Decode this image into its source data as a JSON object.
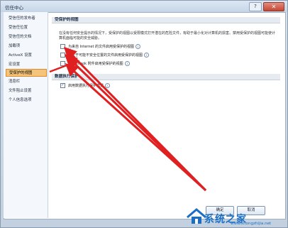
{
  "window": {
    "title": "信任中心",
    "help_label": "?",
    "close_label": "✕"
  },
  "sidebar": {
    "items": [
      {
        "label": "受信任的发布者"
      },
      {
        "label": "受信任位置"
      },
      {
        "label": "受信任的文档"
      },
      {
        "label": "加载项"
      },
      {
        "label": "ActiveX 设置"
      },
      {
        "label": "宏设置"
      },
      {
        "label": "受保护的视图"
      },
      {
        "label": "消息栏"
      },
      {
        "label": "文件阻止设置"
      },
      {
        "label": "个人信息选项"
      }
    ],
    "selected_index": 6
  },
  "protected_view": {
    "header": "受保护的视图",
    "description": "在没有任何安全提示的情况下，受保护的视图以受限模式打开潜在的危险文件，有助于最小化对计算机的损害。禁用受保护的视图可能使计算机面临可能的安全威胁。",
    "options": [
      {
        "label": "为来自 Internet 的文件启用受保护的视图",
        "checked": false
      },
      {
        "label": "为位于可能不安全位置的文件启用受保护的视图",
        "checked": false
      },
      {
        "label": "为 Outlook 附件启用受保护的视图",
        "checked": false
      }
    ]
  },
  "dep": {
    "header": "数据执行保护",
    "option_label": "启用数据执行保护模式",
    "checked": true
  },
  "footer": {
    "ok_label": "确定",
    "cancel_label": "取消"
  },
  "watermark": {
    "brand": "系统之家",
    "url": "www.xitongzhijia.net"
  },
  "colors": {
    "annotation_arrow": "#e02020",
    "selected_bg": "#f3c47a",
    "watermark": "#1a6fc4"
  }
}
